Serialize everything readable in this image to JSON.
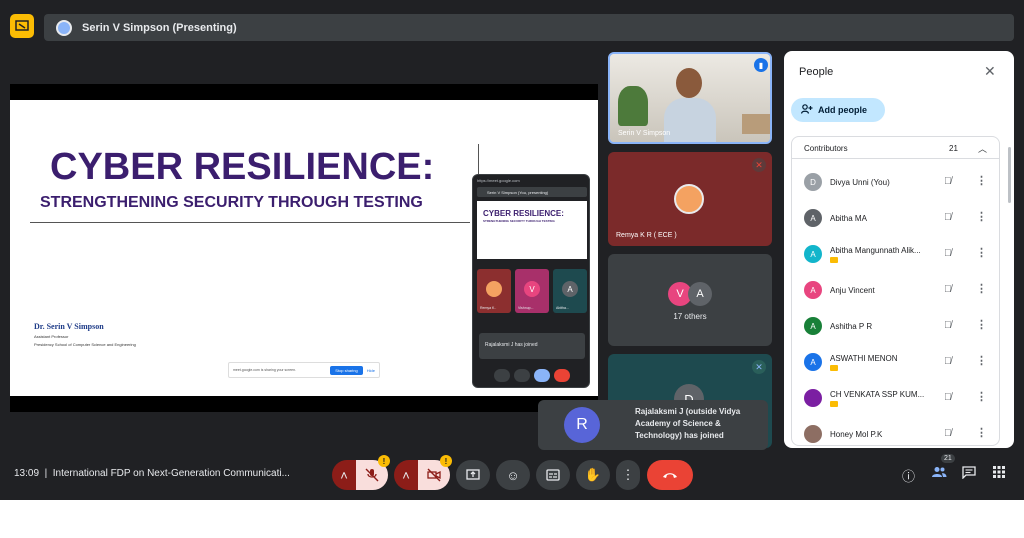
{
  "header": {
    "presenter_label": "Serin V Simpson (Presenting)"
  },
  "slide": {
    "title": "CYBER RESILIENCE:",
    "subtitle": "STRENGTHENING SECURITY THROUGH TESTING",
    "author": "Dr. Serin V Simpson",
    "role": "Assistant Professor",
    "affiliation": "Presidency School of Computer Science and Engineering",
    "share_banner": "meet.google.com is sharing your screen.",
    "stop_sharing": "Stop sharing",
    "hide": "Hide"
  },
  "mini_window": {
    "url": "https://meet.google.com",
    "header": "Serin V Simpson (You, presenting)",
    "slide_title": "CYBER RESILIENCE:",
    "slide_subtitle": "STRENGTHENING SECURITY THROUGH TESTING",
    "tiles": [
      {
        "label": "Remya K..",
        "initial": ""
      },
      {
        "label": "Vishnup...",
        "initial": "V"
      },
      {
        "label": "Abitha...",
        "initial": "A"
      }
    ],
    "toast": "Rajalaksmi J has joined"
  },
  "tiles": [
    {
      "name": "Serin V Simpson"
    },
    {
      "name": "Remya K R ( ECE )"
    },
    {
      "name": "17 others",
      "initials": [
        "V",
        "A"
      ]
    },
    {
      "initial": "D"
    }
  ],
  "join_toast": {
    "initial": "R",
    "text": "Rajalaksmi J (outside Vidya Academy of Science & Technology) has joined"
  },
  "people_panel": {
    "title": "People",
    "add_people": "Add people",
    "section_label": "Contributors",
    "count": "21",
    "people": [
      {
        "name": "Divya Unni (You)",
        "initial": "D",
        "color": "#9aa0a6",
        "tag": false
      },
      {
        "name": "Abitha MA",
        "initial": "A",
        "color": "#5f6368",
        "tag": false
      },
      {
        "name": "Abitha Mangunnath Alik...",
        "initial": "A",
        "color": "#12b5cb",
        "tag": true
      },
      {
        "name": "Anju Vincent",
        "initial": "A",
        "color": "#e8457f",
        "tag": false
      },
      {
        "name": "Ashitha P R",
        "initial": "A",
        "color": "#188038",
        "tag": false
      },
      {
        "name": "ASWATHI MENON",
        "initial": "A",
        "color": "#1a73e8",
        "tag": true
      },
      {
        "name": "CH VENKATA SSP KUM...",
        "initial": "",
        "color": "#7b1fa2",
        "tag": true
      },
      {
        "name": "Honey Mol P.K",
        "initial": "",
        "color": "#8d6e63",
        "tag": false
      }
    ]
  },
  "bottom_bar": {
    "time": "13:09",
    "meeting_title": "International FDP on Next-Generation Communicati...",
    "participant_count": "21"
  },
  "colors": {
    "accent": "#1a73e8",
    "danger": "#ea4335",
    "warning": "#fbbc04",
    "surface": "#202124"
  }
}
